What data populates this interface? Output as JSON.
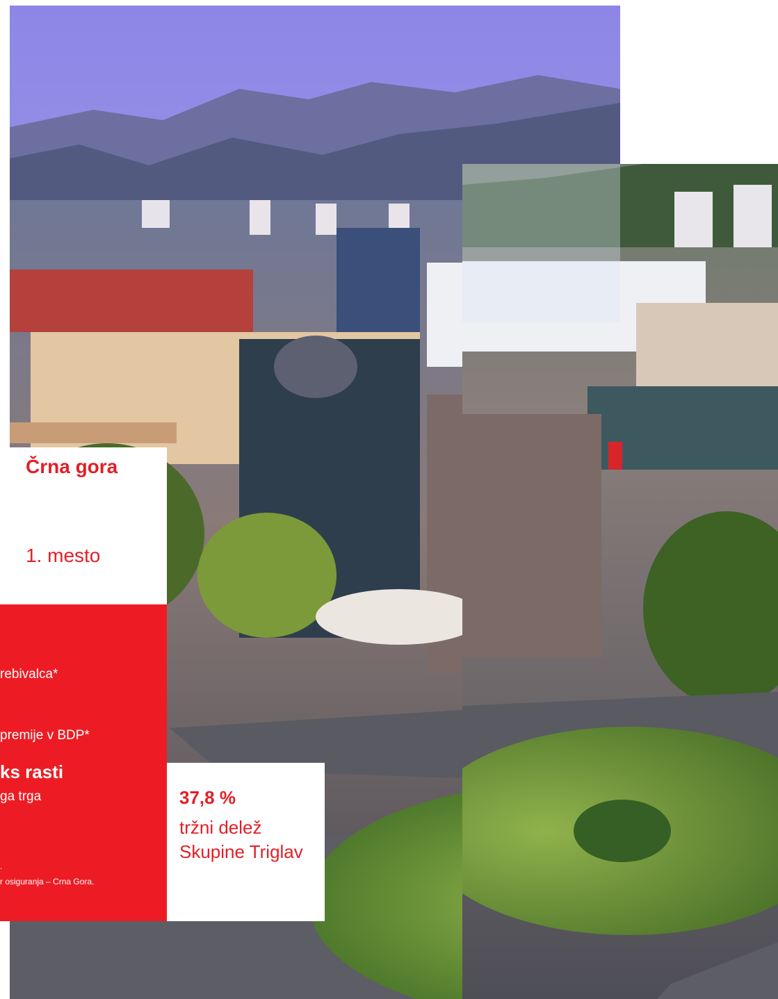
{
  "country": {
    "title": "Črna gora",
    "rank": "1. mesto"
  },
  "stats": {
    "line1": "rebivalca*",
    "line2": "premije v BDP*",
    "line3": "ks rasti",
    "line4": "ga trga",
    "footnote1": ".",
    "footnote2": "r osiguranja – Crna Gora."
  },
  "share": {
    "value": "37,8 %",
    "label": "tržni delež Skupine Triglav"
  },
  "colors": {
    "brand_red": "#ed1c24",
    "text_red": "#e31f26"
  }
}
